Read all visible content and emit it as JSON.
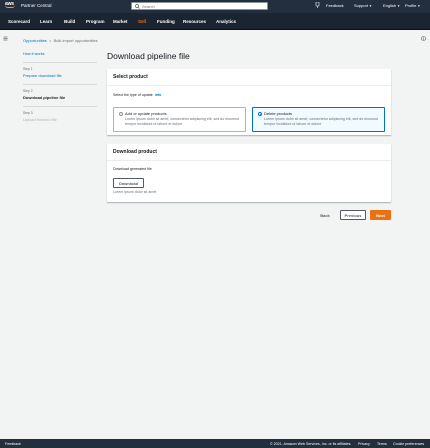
{
  "topbar": {
    "logo_text": "aws",
    "app_title": "Partner Central",
    "search_placeholder": "Search",
    "feedback": "Feedback",
    "support": "Support",
    "language": "English",
    "profile": "Profile"
  },
  "nav": {
    "items": [
      "Scorecard",
      "Learn",
      "Build",
      "Program",
      "Market",
      "Sell",
      "Funding",
      "Resources",
      "Analytics"
    ],
    "active": "Sell"
  },
  "breadcrumb": {
    "parent": "Opportunities",
    "current": "Bulk import opportunities"
  },
  "wizard": {
    "how_it_works": "How it works",
    "steps": [
      {
        "number": "Step 1",
        "label": "Prepare download file"
      },
      {
        "number": "Step 2",
        "label": "Download pipeline file"
      },
      {
        "number": "Step 3",
        "label": "Upload finished file"
      }
    ]
  },
  "page": {
    "title": "Download pipeline file"
  },
  "select_product": {
    "header": "Select product",
    "prompt": "Select the type of update",
    "info": "Info",
    "options": [
      {
        "title": "Add or update products",
        "description": "Lorem ipsum dolor sit amet, consectetur adipiscing elit, sed do eiusmod tempor incididunt ut labore et dolore"
      },
      {
        "title": "Delete products",
        "description": "Lorem ipsum dolor sit amet, consectetur adipiscing elit, sed do eiusmod tempor incididunt ut labore et dolore"
      }
    ],
    "selected_index": 1
  },
  "download_product": {
    "header": "Download product",
    "label": "Download generated file",
    "button": "Download",
    "helper": "Lorem ipsum dolor sit amet"
  },
  "actions": {
    "back": "Back",
    "previous": "Previous",
    "next": "Next"
  },
  "footer": {
    "feedback": "Feedback",
    "copyright": "© 2021, Amazon Web Services, Inc. or its affiliates.",
    "privacy": "Privacy",
    "terms": "Terms",
    "cookie": "Cookie preferences"
  },
  "colors": {
    "topbar": "#232f3e",
    "accent_orange": "#ec7211",
    "link_blue": "#0073bb"
  }
}
